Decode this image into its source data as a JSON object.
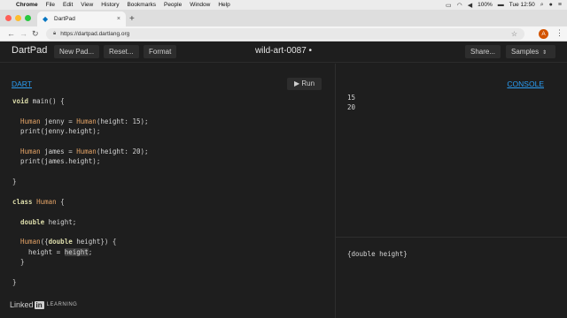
{
  "mac_menubar": {
    "items": [
      "Chrome",
      "File",
      "Edit",
      "View",
      "History",
      "Bookmarks",
      "People",
      "Window",
      "Help"
    ],
    "battery": "100%",
    "clock": "Tue 12:50"
  },
  "browser": {
    "tab_title": "DartPad",
    "url": "https://dartpad.dartlang.org",
    "profile_initial": "A"
  },
  "header": {
    "brand": "DartPad",
    "new_pad": "New Pad...",
    "reset": "Reset...",
    "format": "Format",
    "pad_title": "wild-art-0087 •",
    "share": "Share...",
    "samples": "Samples"
  },
  "editor": {
    "language_label": "DART",
    "run_label": "Run"
  },
  "console": {
    "label": "CONSOLE",
    "output": [
      "15",
      "20"
    ],
    "doc_text": "{double height}"
  },
  "watermark": {
    "linked": "Linked",
    "in": "in",
    "learning": "LEARNING"
  }
}
